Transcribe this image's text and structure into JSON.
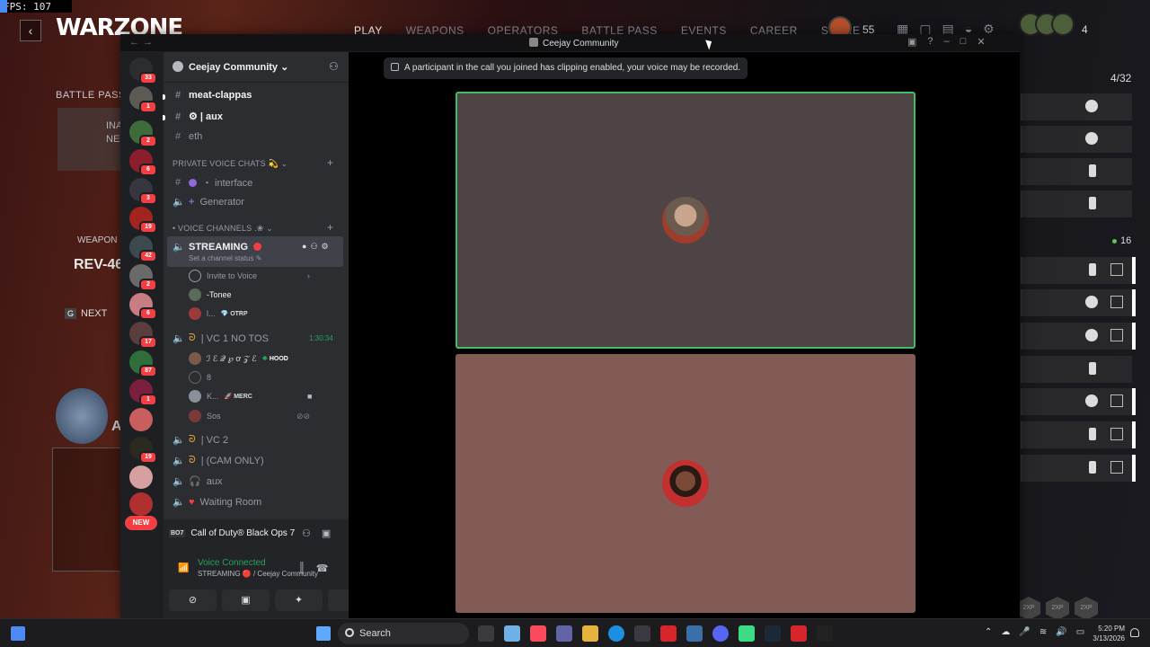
{
  "fps": "FPS: 107",
  "game": {
    "logo": "WARZONE",
    "nav": [
      "PLAY",
      "WEAPONS",
      "OPERATORS",
      "BATTLE PASS",
      "EVENTS",
      "CAREER",
      "STORE"
    ],
    "level": "55",
    "party_count": "4",
    "battle_pass_label": "BATTLE PASS",
    "bp_text_1": "INA",
    "bp_text_2": "NE",
    "weapon_label": "WEAPON",
    "weapon_name": "REV-46",
    "next_key": "G",
    "next_label": "NEXT",
    "partial_letter": "A",
    "roster_count": "4/32",
    "online_count": "16"
  },
  "discord": {
    "window_title": "Ceejay Community",
    "server_name": "Ceejay Community",
    "guild_badges": [
      "33",
      "1",
      "2",
      "6",
      "3",
      "19",
      "42",
      "2",
      "6",
      "17",
      "87",
      "1",
      "",
      "19",
      ""
    ],
    "new_label": "NEW",
    "channels": {
      "text": [
        {
          "name": "meat-clappas",
          "unread": true
        },
        {
          "name": "⚙ | aux",
          "unread": true
        },
        {
          "name": "eth",
          "unread": false
        }
      ],
      "private_category": "PRIVATE VOICE CHATS 💫",
      "private": [
        {
          "name": "・ interface"
        },
        {
          "name": "Generator"
        }
      ],
      "voice_category": "• VOICE CHANNELS .❀",
      "streaming_channel": "STREAMING",
      "status_placeholder": "Set a channel status",
      "invite_to_voice": "Invite to Voice",
      "streaming_members": [
        {
          "name": "-Tonee",
          "tag": ""
        },
        {
          "name": "l...",
          "tag": "OTRP"
        }
      ],
      "vc1_name": "| VC 1 NO TOS",
      "vc1_timer": "1:30:34",
      "vc1_members": [
        {
          "name": "ℐ ℰ 𝒬 ℘ ơ 𝒵 ℰ",
          "tag": "HOOD"
        },
        {
          "name": "8",
          "tag": ""
        },
        {
          "name": "K...",
          "tag": "MERC"
        },
        {
          "name": "Sos",
          "tag": ""
        }
      ],
      "other_voice": [
        "| VC 2",
        "| (CAM ONLY)",
        "aux",
        "Waiting Room"
      ]
    },
    "activity": {
      "game_badge": "BO7",
      "game_name": "Call of Duty® Black Ops 7"
    },
    "voice_connected": "Voice Connected",
    "voice_location": "STREAMING 🔴 / Ceejay Community",
    "clip_notice": "A participant in the call you joined has clipping enabled, your voice may be recorded."
  },
  "taskbar": {
    "search_placeholder": "Search",
    "time": "5:20 PM",
    "date": "3/13/2026"
  }
}
